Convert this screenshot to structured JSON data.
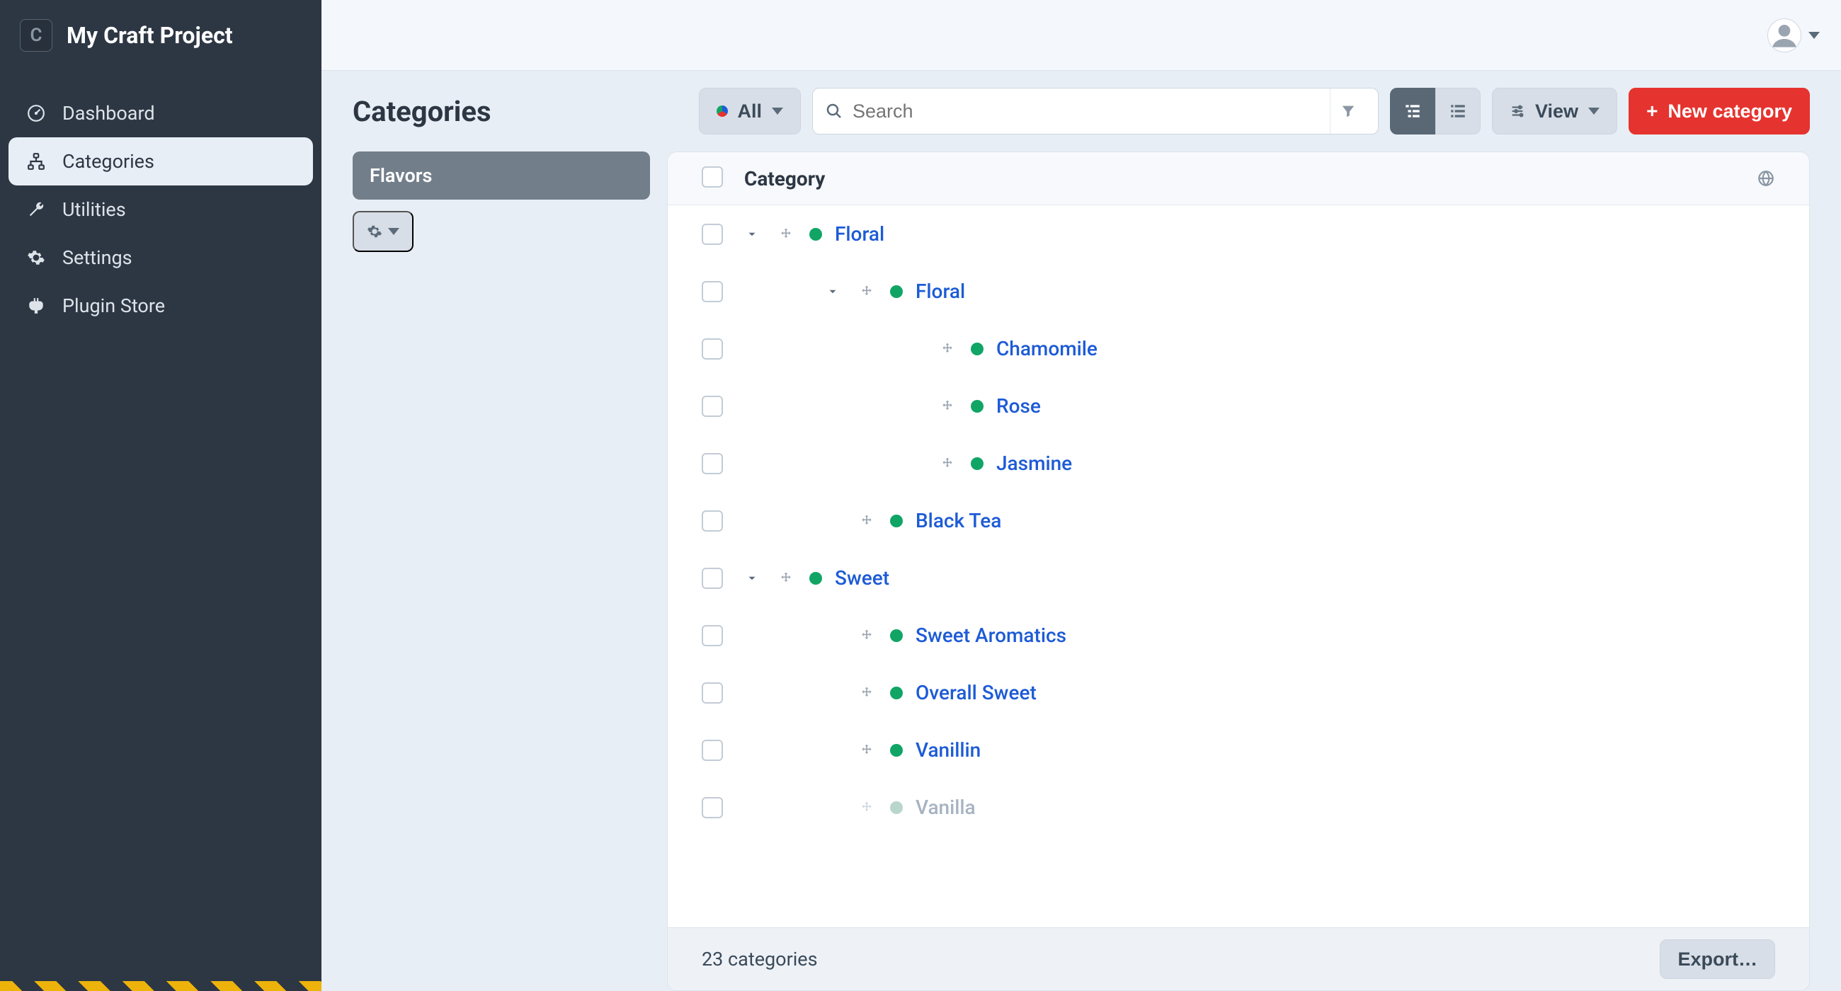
{
  "site": {
    "badge": "C",
    "name": "My Craft Project"
  },
  "nav": {
    "items": [
      {
        "id": "dashboard",
        "label": "Dashboard"
      },
      {
        "id": "categories",
        "label": "Categories"
      },
      {
        "id": "utilities",
        "label": "Utilities"
      },
      {
        "id": "settings",
        "label": "Settings"
      },
      {
        "id": "plugin-store",
        "label": "Plugin Store"
      }
    ],
    "active": "categories"
  },
  "page": {
    "title": "Categories"
  },
  "toolbar": {
    "status_filter": "All",
    "search_placeholder": "Search",
    "view_label": "View",
    "new_label": "New category"
  },
  "sources": {
    "items": [
      {
        "id": "flavors",
        "label": "Flavors",
        "selected": true
      }
    ]
  },
  "table": {
    "header": "Category",
    "rows": [
      {
        "level": 0,
        "expandable": true,
        "label": "Floral",
        "status": "live"
      },
      {
        "level": 1,
        "expandable": true,
        "label": "Floral",
        "status": "live"
      },
      {
        "level": 2,
        "expandable": false,
        "label": "Chamomile",
        "status": "live"
      },
      {
        "level": 2,
        "expandable": false,
        "label": "Rose",
        "status": "live"
      },
      {
        "level": 2,
        "expandable": false,
        "label": "Jasmine",
        "status": "live"
      },
      {
        "level": 1,
        "expandable": false,
        "label": "Black Tea",
        "status": "live"
      },
      {
        "level": 0,
        "expandable": true,
        "label": "Sweet",
        "status": "live"
      },
      {
        "level": 1,
        "expandable": false,
        "label": "Sweet Aromatics",
        "status": "live"
      },
      {
        "level": 1,
        "expandable": false,
        "label": "Overall Sweet",
        "status": "live"
      },
      {
        "level": 1,
        "expandable": false,
        "label": "Vanillin",
        "status": "live"
      },
      {
        "level": 1,
        "expandable": false,
        "label": "Vanilla",
        "status": "draft",
        "muted": true
      }
    ]
  },
  "footer": {
    "count_text": "23 categories",
    "export_label": "Export…"
  }
}
